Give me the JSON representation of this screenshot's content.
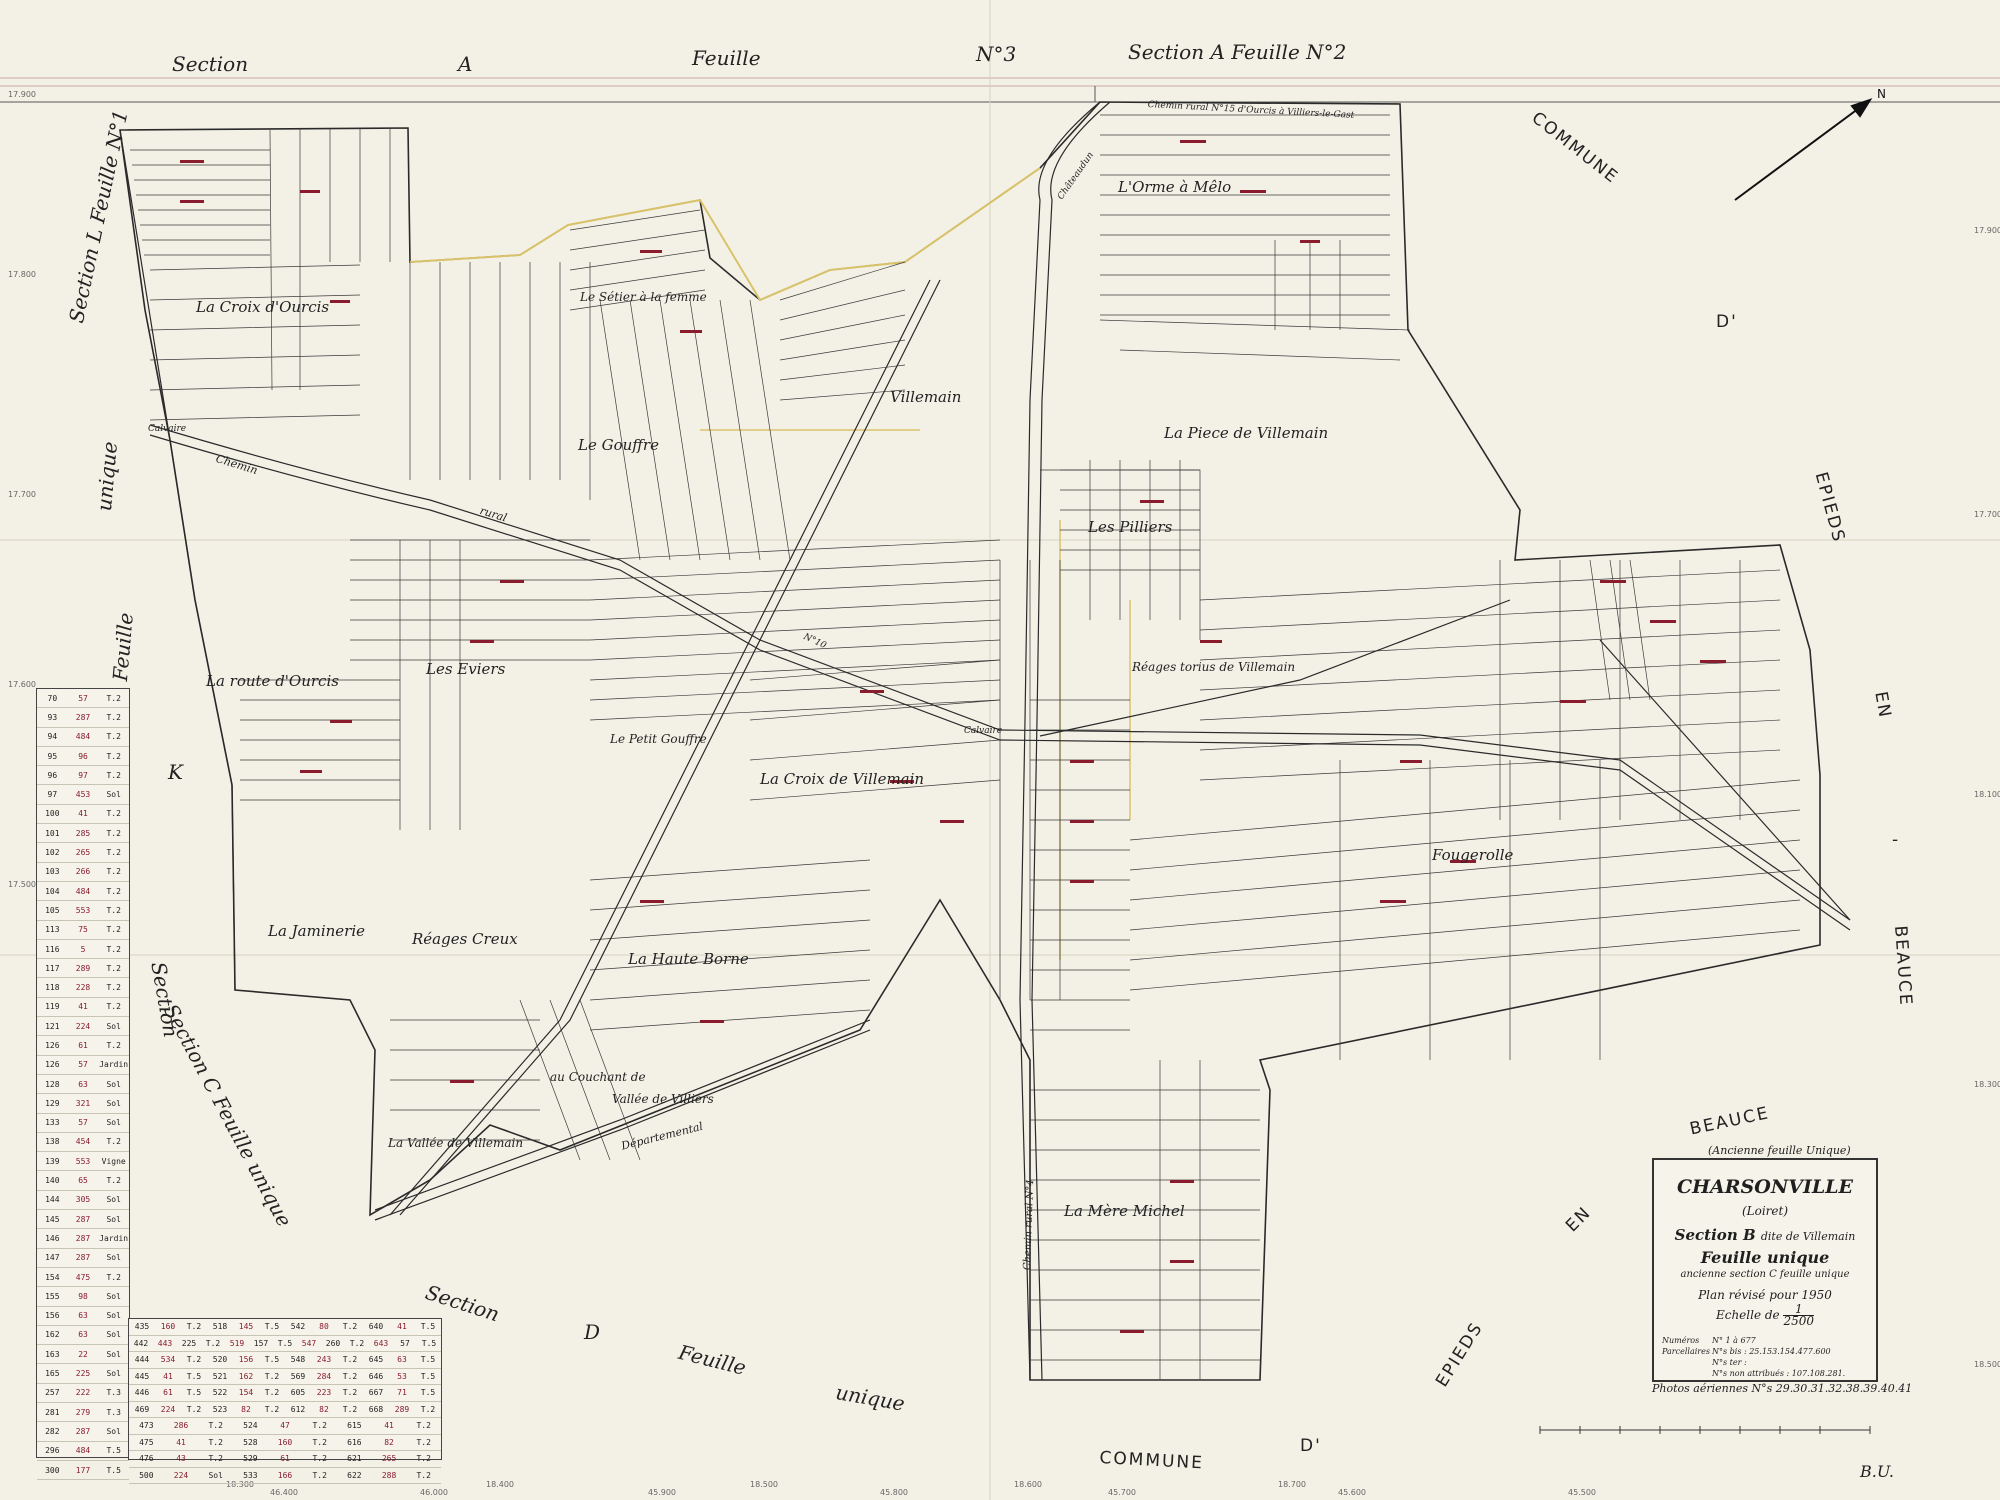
{
  "header": {
    "left": "Section",
    "left_letter": "A",
    "left_feuille": "Feuille",
    "left_no": "N°3",
    "right": "Section A Feuille N°2"
  },
  "sections": {
    "west_top": "Section L Feuille N°1",
    "west_unique": "unique",
    "west_feuille": "Feuille",
    "west_k": "K",
    "west_section": "Section",
    "south_c": "Section C Feuille unique",
    "south_d": "Section",
    "south_d_letter": "D",
    "south_d_feuille": "Feuille",
    "south_d_unique": "unique"
  },
  "communes": {
    "east_top": "COMMUNE",
    "east_d": "D'",
    "east_epieds": "EPIEDS",
    "east_en": "EN",
    "east_dash": "-",
    "east_beauce": "BEAUCE",
    "south_commune": "COMMUNE",
    "south_d": "D'",
    "south_epieds": "EPIEDS",
    "south_en": "EN",
    "south_beauce": "BEAUCE",
    "south_beauce_note": "(Ancienne feuille Unique)"
  },
  "places": {
    "orme": "L'Orme à Mêlo",
    "croix_ourcis": "La Croix d'Ourcis",
    "setier": "Le Sétier à la femme",
    "gouffre": "Le Gouffre",
    "villemain_north": "Villemain",
    "piece_villemain": "La Piece de Villemain",
    "pilliers": "Les Pilliers",
    "route_ourcis": "La route d'Ourcis",
    "eviers": "Les Eviers",
    "petit_gouffre": "Le Petit Gouffre",
    "croix_villemain": "La Croix de Villemain",
    "reages_torius": "Réages torius de Villemain",
    "fougerolle": "Fougerolle",
    "jaminerie": "La Jaminerie",
    "reages_creux": "Réages Creux",
    "haute_borne": "La Haute Borne",
    "couchant": "au Couchant de",
    "vallee_villiers": "Vallée de Villiers",
    "vallee_villemain": "La Vallée de Villemain",
    "mere_michel": "La Mère Michel"
  },
  "roads": {
    "chemin_rural_top": "Chemin rural N°15 d'Ourcis à Villiers-le-Gast",
    "chemin": "Chemin",
    "rural": "rural",
    "calvaire_w": "Calvaire",
    "calvaire_c": "Calvaire",
    "departemental": "Départemental",
    "chateaudun": "Châteaudun",
    "chemin_rural_4": "Chemin rural N°4",
    "n10": "N°10"
  },
  "title_block": {
    "commune": "CHARSONVILLE",
    "dept": "(Loiret)",
    "section": "Section B",
    "section_note": "dite de Villemain",
    "feuille": "Feuille unique",
    "ancienne": "ancienne section C feuille unique",
    "plan": "Plan révisé pour 1950",
    "echelle_label": "Echelle de",
    "echelle_num": "1",
    "echelle_den": "2500",
    "numeros_label": "Numéros Parcellaires",
    "numeros_line1": "N° 1 à 677",
    "numeros_line2": "N°s bis : 25.153.154.477.600",
    "numeros_line3": "N°s ter :",
    "numeros_line4": "N°s non attribués : 107.108.281."
  },
  "photo_caption": "Photos aériennes N°s 29.30.31.32.38.39.40.41",
  "signature": "B.U.",
  "legend_rows": [
    [
      "70",
      "57",
      "T.2"
    ],
    [
      "93",
      "287",
      "T.2"
    ],
    [
      "94",
      "484",
      "T.2"
    ],
    [
      "95",
      "96",
      "T.2"
    ],
    [
      "96",
      "97",
      "T.2"
    ],
    [
      "97",
      "453",
      "Sol"
    ],
    [
      "100",
      "41",
      "T.2"
    ],
    [
      "101",
      "285",
      "T.2"
    ],
    [
      "102",
      "265",
      "T.2"
    ],
    [
      "103",
      "266",
      "T.2"
    ],
    [
      "104",
      "484",
      "T.2"
    ],
    [
      "105",
      "553",
      "T.2"
    ],
    [
      "113",
      "75",
      "T.2"
    ],
    [
      "116",
      "5",
      "T.2"
    ],
    [
      "117",
      "289",
      "T.2"
    ],
    [
      "118",
      "228",
      "T.2"
    ],
    [
      "119",
      "41",
      "T.2"
    ],
    [
      "121",
      "224",
      "Sol"
    ],
    [
      "126",
      "61",
      "T.2"
    ],
    [
      "126",
      "57",
      "Jardin"
    ],
    [
      "128",
      "63",
      "Sol"
    ],
    [
      "129",
      "321",
      "Sol"
    ],
    [
      "133",
      "57",
      "Sol"
    ],
    [
      "138",
      "454",
      "T.2"
    ],
    [
      "139",
      "553",
      "Vigne"
    ],
    [
      "140",
      "65",
      "T.2"
    ],
    [
      "144",
      "305",
      "Sol"
    ],
    [
      "145",
      "287",
      "Sol"
    ],
    [
      "146",
      "287",
      "Jardin"
    ],
    [
      "147",
      "287",
      "Sol"
    ],
    [
      "154",
      "475",
      "T.2"
    ],
    [
      "155",
      "98",
      "Sol"
    ],
    [
      "156",
      "63",
      "Sol"
    ],
    [
      "162",
      "63",
      "Sol"
    ],
    [
      "163",
      "22",
      "Sol"
    ],
    [
      "165",
      "225",
      "Sol"
    ],
    [
      "257",
      "222",
      "T.3"
    ],
    [
      "281",
      "279",
      "T.3"
    ],
    [
      "282",
      "287",
      "Sol"
    ],
    [
      "296",
      "484",
      "T.5"
    ],
    [
      "300",
      "177",
      "T.5"
    ]
  ],
  "bottom_rows": [
    [
      "435",
      "160",
      "T.2",
      "518",
      "145",
      "T.5",
      "542",
      "80",
      "T.2",
      "640",
      "41",
      "T.5"
    ],
    [
      "442",
      "443",
      "225",
      "T.2",
      "519",
      "157",
      "T.5",
      "547",
      "260",
      "T.2",
      "643",
      "57",
      "T.5"
    ],
    [
      "444",
      "534",
      "T.2",
      "520",
      "156",
      "T.5",
      "548",
      "243",
      "T.2",
      "645",
      "63",
      "T.5"
    ],
    [
      "445",
      "41",
      "T.5",
      "521",
      "162",
      "T.2",
      "569",
      "284",
      "T.2",
      "646",
      "53",
      "T.5"
    ],
    [
      "446",
      "61",
      "T.5",
      "522",
      "154",
      "T.2",
      "605",
      "223",
      "T.2",
      "667",
      "71",
      "T.5"
    ],
    [
      "469",
      "224",
      "T.2",
      "523",
      "82",
      "T.2",
      "612",
      "82",
      "T.2",
      "668",
      "289",
      "T.2"
    ],
    [
      "473",
      "286",
      "T.2",
      "524",
      "47",
      "T.2",
      "615",
      "41",
      "T.2"
    ],
    [
      "475",
      "41",
      "T.2",
      "528",
      "160",
      "T.2",
      "616",
      "82",
      "T.2"
    ],
    [
      "476",
      "43",
      "T.2",
      "529",
      "61",
      "T.2",
      "621",
      "265",
      "T.2"
    ],
    [
      "500",
      "224",
      "Sol",
      "533",
      "166",
      "T.2",
      "622",
      "288",
      "T.2"
    ]
  ],
  "coords": {
    "top_left": "17.900",
    "l1": "17.800",
    "l2": "17.700",
    "l3": "17.600",
    "l4": "17.500",
    "b1": "18.300",
    "b2": "18.400",
    "b3": "18.500",
    "b4": "18.600",
    "b5": "18.700",
    "r1": "17.900",
    "r2": "17.700",
    "r3": "18.100",
    "r4": "18.300",
    "r5": "18.500",
    "bx1": "46.400",
    "bx2": "46.000",
    "bx3": "45.900",
    "bx4": "45.800",
    "bx5": "45.700",
    "bx6": "45.600",
    "bx7": "45.500"
  },
  "colors": {
    "paper": "#f3f1e6",
    "ink": "#1f1f1f",
    "red_ink": "#8a1c2e",
    "yellow_line": "#d9c36a"
  }
}
